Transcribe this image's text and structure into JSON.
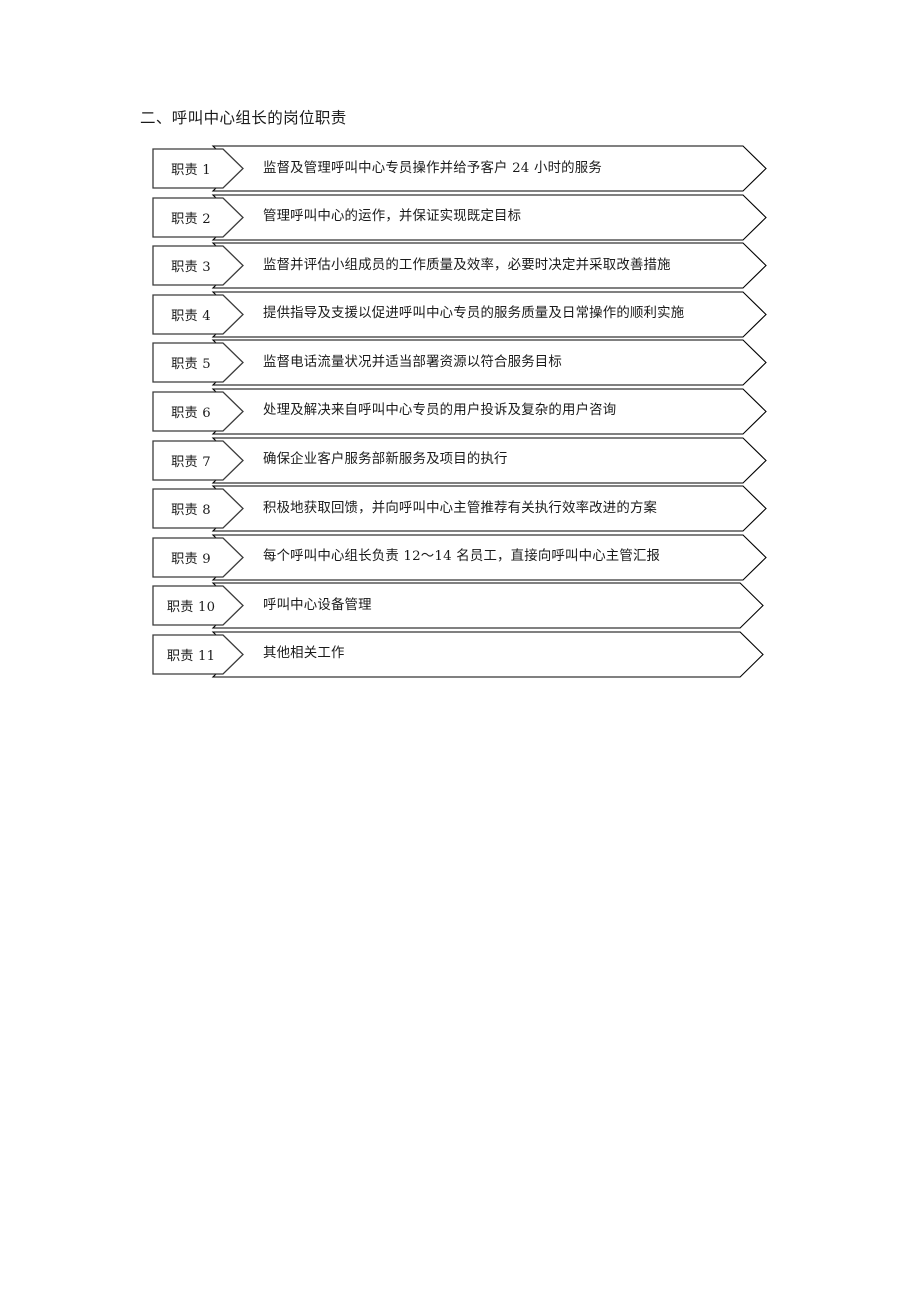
{
  "document": {
    "heading": "二、呼叫中心组长的岗位职责",
    "background_color": "#ffffff",
    "text_color": "#1a1a1a",
    "shape_outline_color": "#000000",
    "shape_fill_color": "#ffffff"
  },
  "duties": [
    {
      "label": "职责 1",
      "text": "监督及管理呼叫中心专员操作并给予客户 24 小时的服务"
    },
    {
      "label": "职责 2",
      "text": "管理呼叫中心的运作，并保证实现既定目标"
    },
    {
      "label": "职责 3",
      "text": "监督并评估小组成员的工作质量及效率，必要时决定并采取改善措施"
    },
    {
      "label": "职责 4",
      "text": "提供指导及支援以促进呼叫中心专员的服务质量及日常操作的顺利实施"
    },
    {
      "label": "职责 5",
      "text": "监督电话流量状况并适当部署资源以符合服务目标"
    },
    {
      "label": "职责 6",
      "text": "处理及解决来自呼叫中心专员的用户投诉及复杂的用户咨询"
    },
    {
      "label": "职责 7",
      "text": "确保企业客户服务部新服务及项目的执行"
    },
    {
      "label": "职责 8",
      "text": "积极地获取回馈，并向呼叫中心主管推荐有关执行效率改进的方案"
    },
    {
      "label": "职责 9",
      "text": "每个呼叫中心组长负责 12～14 名员工，直接向呼叫中心主管汇报"
    },
    {
      "label": "职责 10",
      "text": "呼叫中心设备管理"
    },
    {
      "label": "职责 11",
      "text": "其他相关工作"
    }
  ]
}
